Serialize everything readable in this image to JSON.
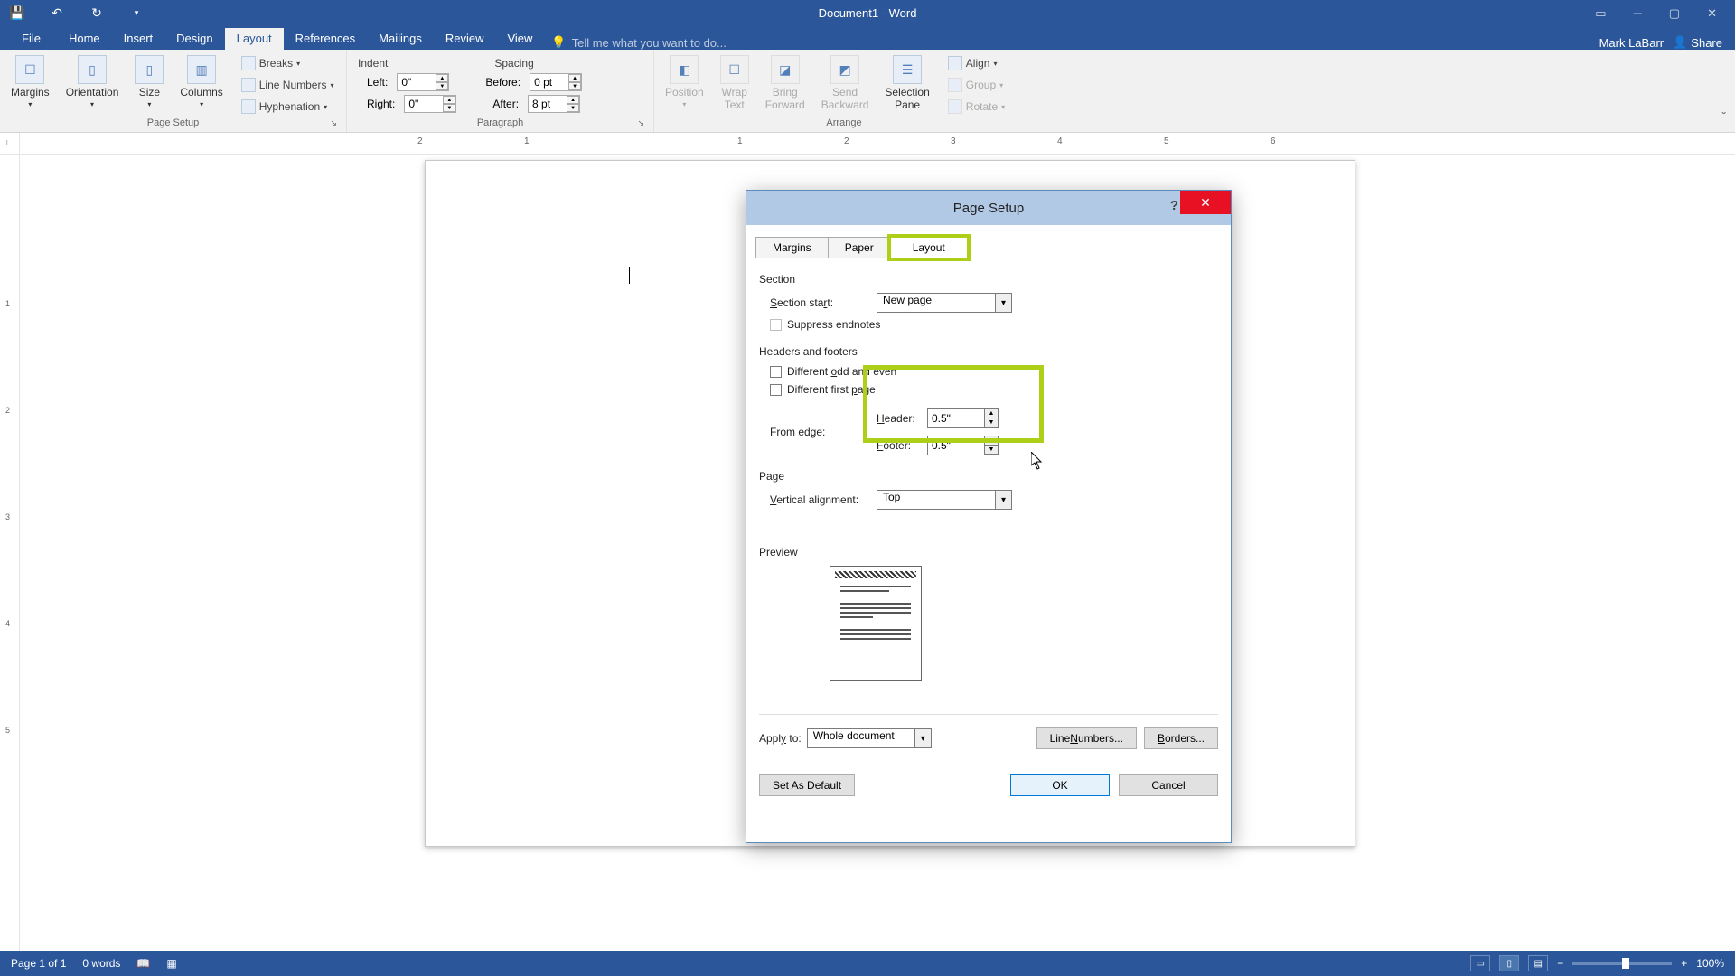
{
  "titlebar": {
    "title": "Document1 - Word"
  },
  "user": {
    "name": "Mark LaBarr",
    "share": "Share"
  },
  "tabs": {
    "file": "File",
    "home": "Home",
    "insert": "Insert",
    "design": "Design",
    "layout": "Layout",
    "references": "References",
    "mailings": "Mailings",
    "review": "Review",
    "view": "View",
    "tell_me": "Tell me what you want to do..."
  },
  "ribbon": {
    "page_setup": {
      "margins": "Margins",
      "orientation": "Orientation",
      "size": "Size",
      "columns": "Columns",
      "breaks": "Breaks",
      "line_numbers": "Line Numbers",
      "hyphenation": "Hyphenation",
      "caption": "Page Setup"
    },
    "paragraph": {
      "indent_h": "Indent",
      "spacing_h": "Spacing",
      "left": "Left:",
      "left_v": "0\"",
      "right": "Right:",
      "right_v": "0\"",
      "before": "Before:",
      "before_v": "0 pt",
      "after": "After:",
      "after_v": "8 pt",
      "caption": "Paragraph"
    },
    "arrange": {
      "position": "Position",
      "wrap": "Wrap\nText",
      "bring": "Bring\nForward",
      "send": "Send\nBackward",
      "selection": "Selection\nPane",
      "align": "Align",
      "group": "Group",
      "rotate": "Rotate",
      "caption": "Arrange"
    }
  },
  "ruler_h": {
    "n2": "2",
    "n1": "1",
    "p1": "1",
    "p2": "2",
    "p3": "3",
    "p4": "4",
    "p5": "5",
    "p6": "6"
  },
  "ruler_v": {
    "p1": "1",
    "p2": "2",
    "p3": "3",
    "p4": "4",
    "p5": "5"
  },
  "dialog": {
    "title": "Page Setup",
    "tabs": {
      "margins": "Margins",
      "paper": "Paper",
      "layout": "Layout"
    },
    "section": {
      "heading": "Section",
      "start_label": "Section start:",
      "start_value": "New page",
      "suppress": "Suppress endnotes"
    },
    "hf": {
      "heading": "Headers and footers",
      "odd_even": "Different odd and even",
      "first_page": "Different first page",
      "from_edge": "From edge:",
      "header_label": "Header:",
      "header_value": "0.5\"",
      "footer_label": "Footer:",
      "footer_value": "0.5\""
    },
    "page": {
      "heading": "Page",
      "valign_label": "Vertical alignment:",
      "valign_value": "Top"
    },
    "preview": {
      "heading": "Preview"
    },
    "apply": {
      "label": "Apply to:",
      "value": "Whole document",
      "line_numbers": "Line Numbers...",
      "borders": "Borders..."
    },
    "buttons": {
      "default": "Set As Default",
      "ok": "OK",
      "cancel": "Cancel"
    }
  },
  "status": {
    "page": "Page 1 of 1",
    "words": "0 words",
    "zoom": "100%",
    "plus": "+",
    "minus": "−"
  }
}
